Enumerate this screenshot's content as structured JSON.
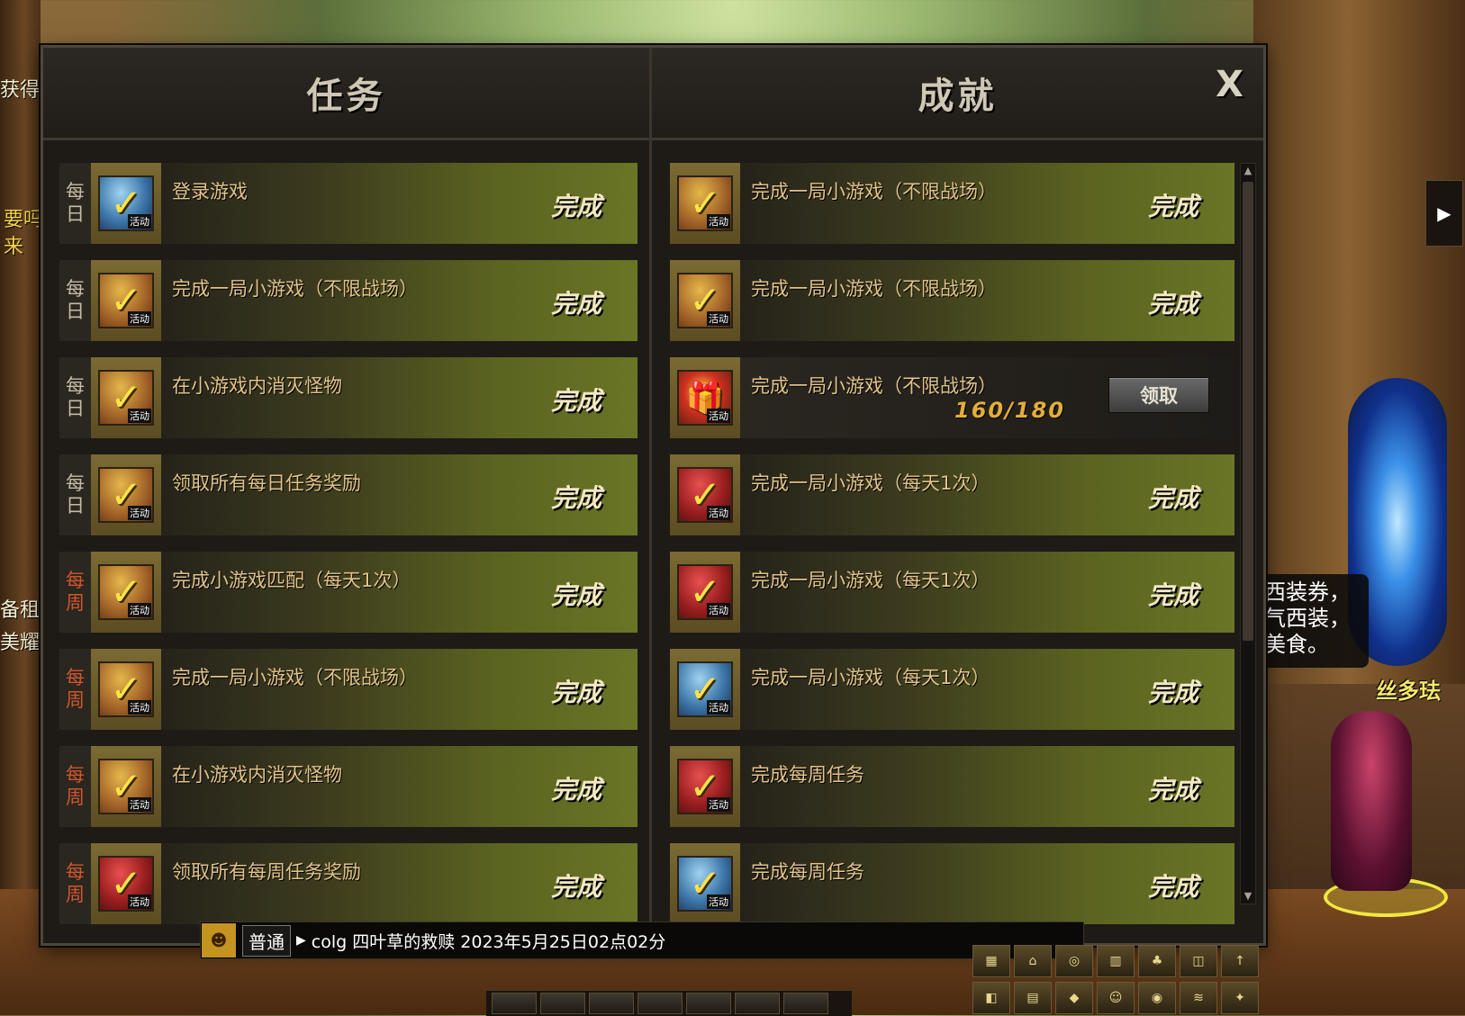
{
  "background": {
    "left_text_lines": [
      "获得",
      "要吗",
      "来",
      "备租",
      "美耀"
    ],
    "npc": {
      "bubble_lines": [
        "西装券，",
        "气西装，",
        "美食。"
      ],
      "name": "丝多珐"
    }
  },
  "panel": {
    "close_label": "X",
    "quests": {
      "title": "任务",
      "rows": [
        {
          "period": [
            "每",
            "日"
          ],
          "weekly": false,
          "title": "登录游戏",
          "status": "完成"
        },
        {
          "period": [
            "每",
            "日"
          ],
          "weekly": false,
          "title": "完成一局小游戏（不限战场）",
          "status": "完成"
        },
        {
          "period": [
            "每",
            "日"
          ],
          "weekly": false,
          "title": "在小游戏内消灭怪物",
          "status": "完成"
        },
        {
          "period": [
            "每",
            "日"
          ],
          "weekly": false,
          "title": "领取所有每日任务奖励",
          "status": "完成"
        },
        {
          "period": [
            "每",
            "周"
          ],
          "weekly": true,
          "title": "完成小游戏匹配（每天1次）",
          "status": "完成"
        },
        {
          "period": [
            "每",
            "周"
          ],
          "weekly": true,
          "title": "完成一局小游戏（不限战场）",
          "status": "完成"
        },
        {
          "period": [
            "每",
            "周"
          ],
          "weekly": true,
          "title": "在小游戏内消灭怪物",
          "status": "完成"
        },
        {
          "period": [
            "每",
            "周"
          ],
          "weekly": true,
          "title": "领取所有每周任务奖励",
          "status": "完成"
        }
      ]
    },
    "achievements": {
      "title": "成就",
      "rows": [
        {
          "title": "完成一局小游戏（不限战场）",
          "status": "完成",
          "icon": "check-gold-icon"
        },
        {
          "title": "完成一局小游戏（不限战场）",
          "status": "完成",
          "icon": "check-gold-icon"
        },
        {
          "title": "完成一局小游戏（不限战场）",
          "progress": "160/180",
          "button": "领取",
          "icon": "gift-icon"
        },
        {
          "title": "完成一局小游戏（每天1次）",
          "status": "完成",
          "icon": "check-red-icon"
        },
        {
          "title": "完成一局小游戏（每天1次）",
          "status": "完成",
          "icon": "check-red-icon"
        },
        {
          "title": "完成一局小游戏（每天1次）",
          "status": "完成",
          "icon": "check-blue-icon"
        },
        {
          "title": "完成每周任务",
          "status": "完成",
          "icon": "check-red-icon"
        },
        {
          "title": "完成每周任务",
          "status": "完成",
          "icon": "check-blue-icon"
        }
      ]
    }
  },
  "chat": {
    "channel": "普通",
    "message": "colg 四叶草的救赎 2023年5月25日02点02分"
  },
  "colors": {
    "panel_bg": "#1e1b17",
    "complete_green": "#6a7526",
    "weekly_red": "#d2562d",
    "progress_orange": "#e3ad3a"
  }
}
